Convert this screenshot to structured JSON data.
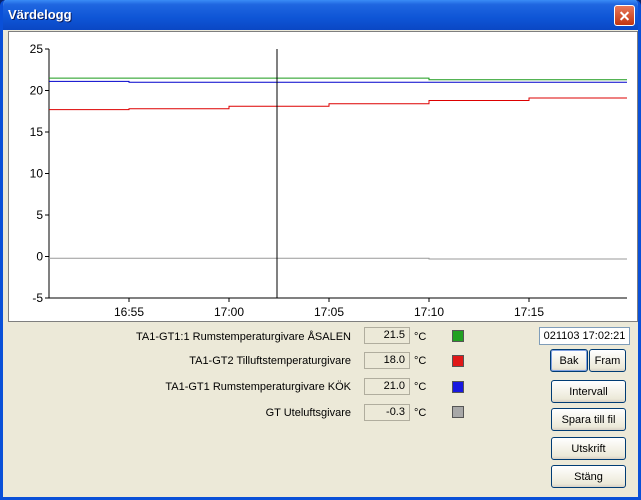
{
  "window": {
    "title": "Värdelogg"
  },
  "chart_data": {
    "type": "line",
    "y_ticks": [
      "25",
      "20",
      "15",
      "10",
      "5",
      "0",
      "-5"
    ],
    "y_tick_values": [
      25,
      20,
      15,
      10,
      5,
      0,
      -5
    ],
    "ylim": [
      -5,
      25
    ],
    "x_ticks": [
      "16:55",
      "17:00",
      "17:05",
      "17:10",
      "17:15"
    ],
    "x_tick_minutes": [
      55,
      60,
      65,
      70,
      75
    ],
    "xlim_minutes": [
      51.0,
      79.9
    ],
    "cursor_minutes": 62.4,
    "series": [
      {
        "color": "#1a9a1a",
        "x": [
          51.0,
          70.0,
          70.0,
          79.9
        ],
        "values": [
          21.5,
          21.5,
          21.3,
          21.3
        ]
      },
      {
        "color": "#0000cc",
        "x": [
          51.0,
          55.0,
          55.0,
          79.9
        ],
        "values": [
          21.1,
          21.1,
          21.0,
          21.0
        ]
      },
      {
        "color": "#dd0000",
        "x": [
          51.0,
          55.0,
          55.0,
          60.0,
          60.0,
          65.0,
          65.0,
          70.0,
          70.0,
          75.0,
          75.0,
          79.9
        ],
        "values": [
          17.7,
          17.7,
          17.8,
          17.8,
          18.1,
          18.1,
          18.4,
          18.4,
          18.8,
          18.8,
          19.1,
          19.1
        ]
      },
      {
        "color": "#999999",
        "x": [
          51.0,
          70.0,
          70.0,
          79.9
        ],
        "values": [
          -0.2,
          -0.2,
          -0.3,
          -0.3
        ]
      }
    ]
  },
  "readings": [
    {
      "label": "TA1-GT1:1 Rumstemperaturgivare ÅSALEN",
      "value": "21.5",
      "unit": "°C",
      "color": "#22a022"
    },
    {
      "label": "TA1-GT2 Tilluftstemperaturgivare",
      "value": "18.0",
      "unit": "°C",
      "color": "#e01818"
    },
    {
      "label": "TA1-GT1 Rumstemperaturgivare KÖK",
      "value": "21.0",
      "unit": "°C",
      "color": "#1818e0"
    },
    {
      "label": "GT Uteluftsgivare",
      "value": "-0.3",
      "unit": "°C",
      "color": "#a8a8a8"
    }
  ],
  "controls": {
    "datetime": "021103  17:02:21",
    "back_label": "Bak",
    "forward_label": "Fram",
    "interval_label": "Intervall",
    "save_label": "Spara till fil",
    "print_label": "Utskrift",
    "close_label": "Stäng"
  }
}
